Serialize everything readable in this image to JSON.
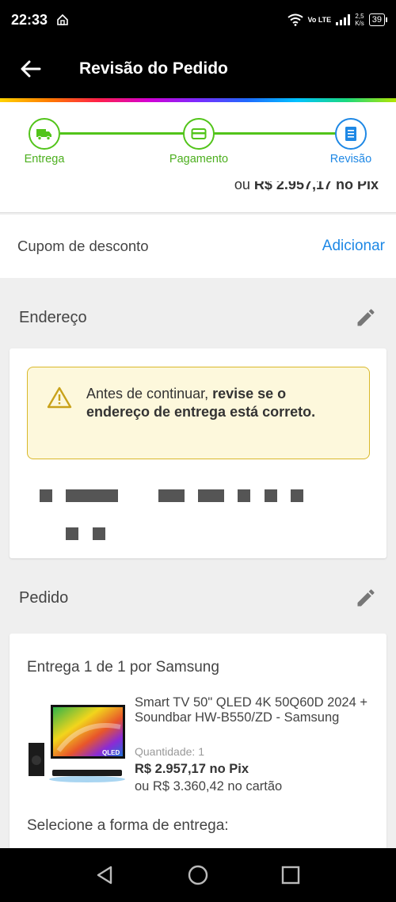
{
  "status_bar": {
    "time": "22:33",
    "network": "Vo LTE",
    "speed_value": "2,5",
    "speed_unit": "K/s",
    "battery": "39"
  },
  "app_bar": {
    "title": "Revisão do Pedido",
    "back_icon": "arrow-left-icon"
  },
  "stepper": {
    "steps": [
      {
        "label": "Entrega",
        "icon": "truck-icon",
        "state": "done"
      },
      {
        "label": "Pagamento",
        "icon": "credit-card-icon",
        "state": "done"
      },
      {
        "label": "Revisão",
        "icon": "document-icon",
        "state": "active"
      }
    ],
    "colors": {
      "done": "#52c41a",
      "active": "#1e88e5"
    }
  },
  "price_strip": {
    "prefix": "ou",
    "value": "R$ 2.957,17 no Pix"
  },
  "coupon": {
    "label": "Cupom de desconto",
    "action": "Adicionar"
  },
  "address_section": {
    "title": "Endereço",
    "edit_icon": "pencil-icon",
    "warning": {
      "icon": "warning-triangle-icon",
      "text_plain": "Antes de continuar, ",
      "text_bold": "revise se o endereço de entrega está correto."
    }
  },
  "order_section": {
    "title": "Pedido",
    "edit_icon": "pencil-icon",
    "delivery_title": "Entrega 1 de 1 por Samsung",
    "product": {
      "name": "Smart TV 50\" QLED 4K 50Q60D 2024 + Soundbar HW-B550/ZD - Samsung",
      "quantity_label": "Quantidade:",
      "quantity_value": "1",
      "price_pix": "R$ 2.957,17 no Pix",
      "price_card": "ou R$ 3.360,42 no cartão",
      "image_text": "QLED"
    },
    "shipping_prompt": "Selecione a forma de entrega:"
  },
  "nav_bar": {
    "back": "back-triangle-icon",
    "home": "home-circle-icon",
    "recents": "recents-square-icon"
  }
}
